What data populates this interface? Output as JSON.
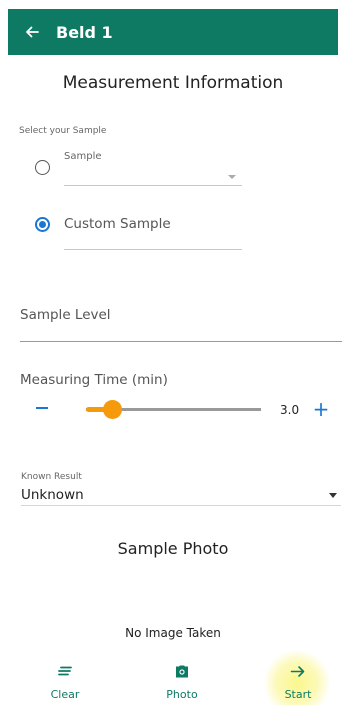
{
  "appbar": {
    "title": "Beld 1",
    "back_icon": "arrow-left-icon",
    "color": "#0e7a64"
  },
  "measurement": {
    "title": "Measurement Information",
    "select_label": "Select your Sample",
    "sample_option": {
      "label": "Sample",
      "value": "",
      "selected": false
    },
    "custom_option": {
      "label": "Custom Sample",
      "value": "",
      "selected": true
    },
    "sample_level_label": "Sample Level",
    "measuring_time": {
      "label": "Measuring Time (min)",
      "value": "3.0",
      "fraction": 0.15,
      "minus_icon": "minus-icon",
      "plus_icon": "plus-icon"
    },
    "known_result": {
      "label": "Known Result",
      "value": "Unknown"
    }
  },
  "photo": {
    "title": "Sample Photo",
    "status": "No Image Taken"
  },
  "bottom_nav": {
    "clear": {
      "label": "Clear",
      "icon": "clear-lines-icon"
    },
    "photo": {
      "label": "Photo",
      "icon": "camera-icon"
    },
    "start": {
      "label": "Start",
      "icon": "arrow-right-icon"
    }
  },
  "colors": {
    "accent": "#0e7a64",
    "primary": "#1a76d2",
    "slider": "#f59a0c"
  }
}
